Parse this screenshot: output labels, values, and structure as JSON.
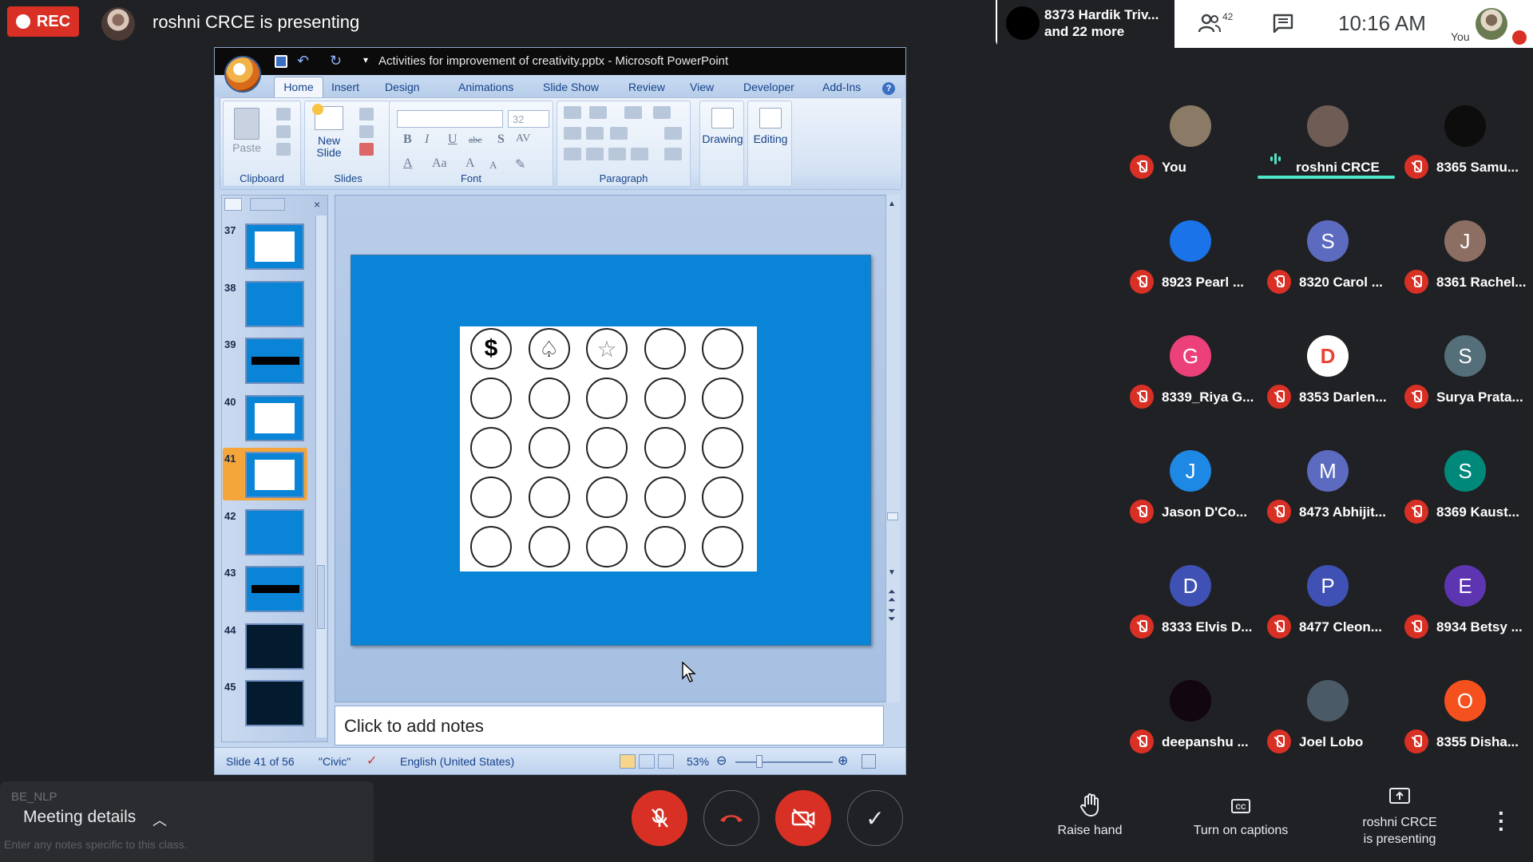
{
  "top_bar": {
    "rec_label": "REC",
    "presenting_text": "roshni CRCE is presenting",
    "other_participants_line1": "8373 Hardik Triv...",
    "other_participants_line2": "and 22 more",
    "people_count": "42",
    "time": "10:16 AM",
    "you_label": "You"
  },
  "powerpoint": {
    "window_title": "Activities for improvement of creativity.pptx - Microsoft PowerPoint",
    "tabs": [
      "Home",
      "Insert",
      "Design",
      "Animations",
      "Slide Show",
      "Review",
      "View",
      "Developer",
      "Add-Ins"
    ],
    "ribbon": {
      "paste": "Paste",
      "clipboard": "Clipboard",
      "new_slide_1": "New",
      "new_slide_2": "Slide",
      "slides": "Slides",
      "font_size": "32",
      "font": "Font",
      "paragraph": "Paragraph",
      "drawing": "Drawing",
      "editing": "Editing"
    },
    "slide_numbers": [
      "37",
      "38",
      "39",
      "40",
      "41",
      "42",
      "43",
      "44",
      "45"
    ],
    "selected_slide": "41",
    "slide_symbols": [
      "$",
      "♤",
      "☆"
    ],
    "notes_placeholder": "Click to add notes",
    "status": {
      "slide_of": "Slide 41 of 56",
      "theme": "\"Civic\"",
      "language": "English (United States)",
      "zoom": "53%"
    }
  },
  "participants": [
    {
      "name": "You",
      "initial": "",
      "color": "#8b7a66"
    },
    {
      "name": "roshni CRCE",
      "initial": "",
      "color": "#6f5d55"
    },
    {
      "name": "8365 Samu...",
      "initial": "",
      "color": "#0d0d0d"
    },
    {
      "name": "8923 Pearl ...",
      "initial": "",
      "color": "#1a73e8"
    },
    {
      "name": "8320 Carol ...",
      "initial": "S",
      "color": "#5c6bc0"
    },
    {
      "name": "8361 Rachel...",
      "initial": "J",
      "color": "#8d6e63"
    },
    {
      "name": "8339_Riya G...",
      "initial": "G",
      "color": "#ec407a"
    },
    {
      "name": "8353 Darlen...",
      "initial": "D",
      "color": "#ffffff"
    },
    {
      "name": "Surya Prata...",
      "initial": "S",
      "color": "#546e7a"
    },
    {
      "name": "Jason D'Co...",
      "initial": "J",
      "color": "#1e88e5"
    },
    {
      "name": "8473 Abhijit...",
      "initial": "M",
      "color": "#5c6bc0"
    },
    {
      "name": "8369 Kaust...",
      "initial": "S",
      "color": "#00897b"
    },
    {
      "name": "8333 Elvis D...",
      "initial": "D",
      "color": "#3f51b5"
    },
    {
      "name": "8477 Cleon...",
      "initial": "P",
      "color": "#3f51b5"
    },
    {
      "name": "8934 Betsy ...",
      "initial": "E",
      "color": "#5e35b1"
    },
    {
      "name": "deepanshu ...",
      "initial": "",
      "color": "#120610"
    },
    {
      "name": "Joel Lobo",
      "initial": "",
      "color": "#4a5a66"
    },
    {
      "name": "8355 Disha...",
      "initial": "O",
      "color": "#f4511e"
    }
  ],
  "bottom_bar": {
    "meeting_details": "Meeting details",
    "ghost_text": "BE_NLP",
    "ghost_notes": "Enter any notes specific to this class.",
    "raise_hand": "Raise hand",
    "captions": "Turn on captions",
    "presenting_line1": "roshni CRCE",
    "presenting_line2": "is presenting"
  }
}
